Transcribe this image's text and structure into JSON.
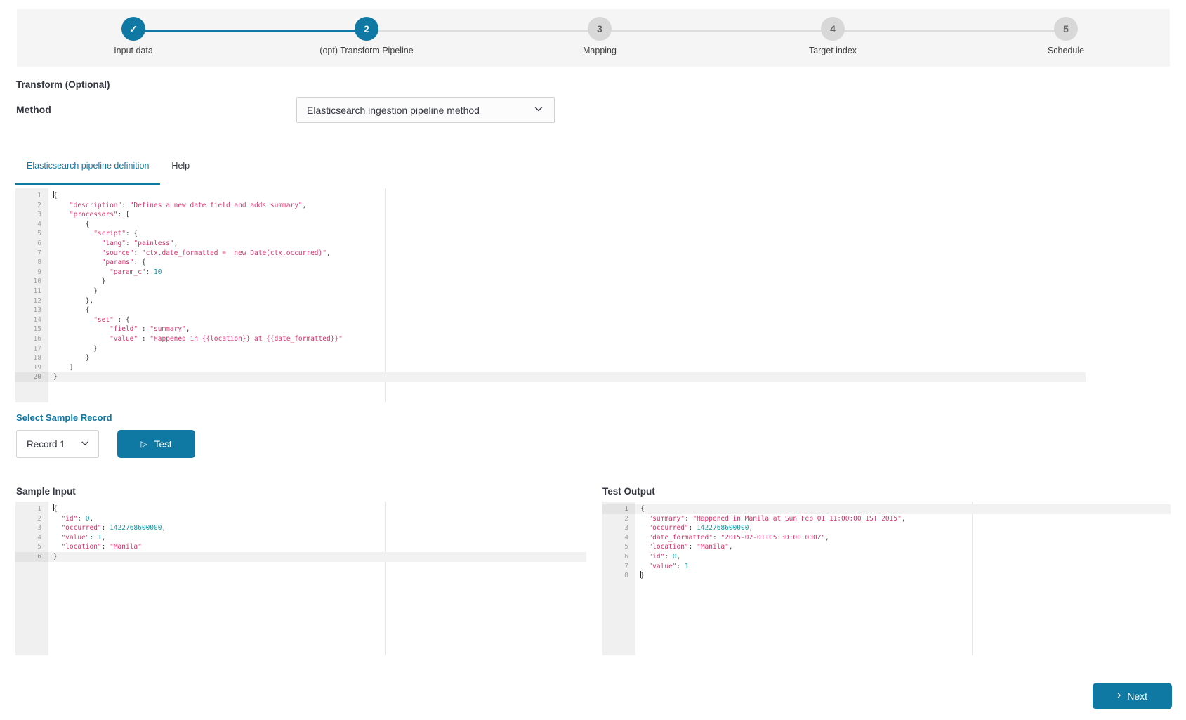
{
  "stepper": {
    "steps": [
      {
        "id": "input-data",
        "label": "Input data",
        "marker": "check",
        "state": "complete"
      },
      {
        "id": "transform-pipeline",
        "label": "(opt) Transform Pipeline",
        "marker": "2",
        "state": "active"
      },
      {
        "id": "mapping",
        "label": "Mapping",
        "marker": "3",
        "state": "upcoming"
      },
      {
        "id": "target-index",
        "label": "Target index",
        "marker": "4",
        "state": "upcoming"
      },
      {
        "id": "schedule",
        "label": "Schedule",
        "marker": "5",
        "state": "upcoming"
      }
    ]
  },
  "transform_section": {
    "title": "Transform (Optional)",
    "method_label": "Method",
    "method_selected": "Elasticsearch ingestion pipeline method"
  },
  "editor_tabs": [
    {
      "id": "pipeline-definition",
      "label": "Elasticsearch pipeline definition",
      "active": true
    },
    {
      "id": "help",
      "label": "Help",
      "active": false
    }
  ],
  "pipeline_editor": {
    "active_line": 20,
    "cursor_line": 1,
    "lines": [
      "{",
      "    \"description\": \"Defines a new date field and adds summary\",",
      "    \"processors\": [",
      "        {",
      "          \"script\": {",
      "            \"lang\": \"painless\",",
      "            \"source\": \"ctx.date_formatted =  new Date(ctx.occurred)\",",
      "            \"params\": {",
      "              \"param_c\": 10",
      "            }",
      "          }",
      "        },",
      "        {",
      "          \"set\" : {",
      "              \"field\" : \"summary\",",
      "              \"value\" : \"Happened in {{location}} at {{date_formatted}}\"",
      "          }",
      "        }",
      "    ]",
      "}"
    ]
  },
  "sample_section": {
    "title": "Select Sample Record",
    "record_selected": "Record 1",
    "test_button_label": "Test",
    "play_icon": "▷"
  },
  "sample_input": {
    "title": "Sample Input",
    "editor": {
      "active_line": 6,
      "cursor_line": 1,
      "lines": [
        "{",
        "  \"id\": 0,",
        "  \"occurred\": 1422768600000,",
        "  \"value\": 1,",
        "  \"location\": \"Manila\"",
        "}"
      ]
    }
  },
  "test_output": {
    "title": "Test Output",
    "editor": {
      "active_line": 1,
      "cursor_line": 8,
      "lines": [
        "{",
        "  \"summary\": \"Happened in Manila at Sun Feb 01 11:00:00 IST 2015\",",
        "  \"occurred\": 1422768600000,",
        "  \"date_formatted\": \"2015-02-01T05:30:00.000Z\",",
        "  \"location\": \"Manila\",",
        "  \"id\": 0,",
        "  \"value\": 1",
        "}"
      ]
    }
  },
  "footer": {
    "next_label": "Next",
    "next_icon": "›"
  },
  "colors": {
    "primary": "#0f79a3",
    "code_string": "#d6336c",
    "code_number": "#0d99a5",
    "stepper_bar_bg": "#f5f5f5"
  }
}
